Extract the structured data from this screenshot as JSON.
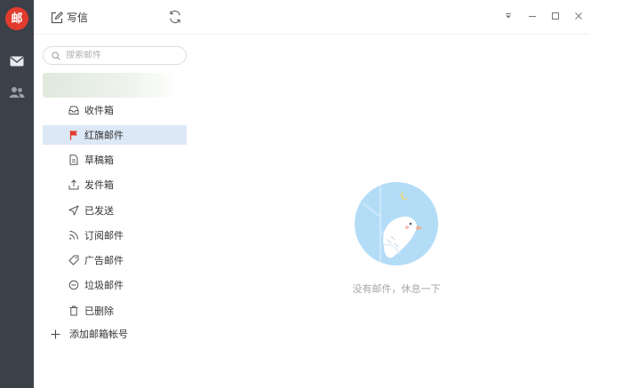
{
  "rail": {
    "logo_text": "邮",
    "brand_color": "#e23b2e",
    "background_color": "#3c4049",
    "items": [
      {
        "icon": "mail-icon"
      },
      {
        "icon": "contacts-icon"
      }
    ]
  },
  "header": {
    "compose_label": "写信",
    "compose_icon": "edit-icon",
    "refresh_icon": "refresh-icon",
    "window_controls": [
      "menu-icon",
      "minimize-icon",
      "maximize-icon",
      "close-icon"
    ]
  },
  "search": {
    "placeholder": "搜索邮件",
    "value": ""
  },
  "folders": [
    {
      "label": "收件箱",
      "icon": "inbox-icon",
      "active": false
    },
    {
      "label": "红旗邮件",
      "icon": "flag-icon",
      "active": true
    },
    {
      "label": "草稿箱",
      "icon": "draft-icon",
      "active": false
    },
    {
      "label": "发件箱",
      "icon": "outbox-icon",
      "active": false
    },
    {
      "label": "已发送",
      "icon": "sent-icon",
      "active": false
    },
    {
      "label": "订阅邮件",
      "icon": "rss-icon",
      "active": false
    },
    {
      "label": "广告邮件",
      "icon": "tag-icon",
      "active": false
    },
    {
      "label": "垃圾邮件",
      "icon": "spam-icon",
      "active": false
    },
    {
      "label": "已删除",
      "icon": "trash-icon",
      "active": false
    }
  ],
  "add_account_label": "添加邮箱帐号",
  "empty_state": {
    "message": "没有邮件，休息一下",
    "illustration": "dove-moon-illustration",
    "accent_color": "#b3dcf7"
  },
  "colors": {
    "active_folder_bg": "#dde8f6",
    "flag": "#e23b2e"
  }
}
